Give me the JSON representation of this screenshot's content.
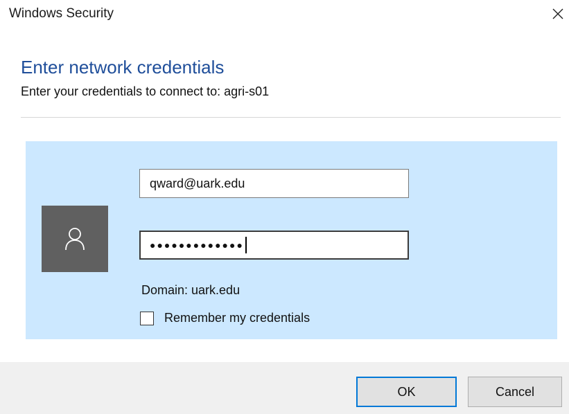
{
  "window": {
    "title": "Windows Security"
  },
  "header": {
    "heading": "Enter network credentials",
    "subheading": "Enter your credentials to connect to: agri-s01"
  },
  "credentials": {
    "username_value": "qward@uark.edu",
    "password_mask": "●●●●●●●●●●●●●",
    "domain_text": "Domain: uark.edu",
    "remember_label": "Remember my credentials",
    "remember_checked": false
  },
  "buttons": {
    "ok_label": "OK",
    "cancel_label": "Cancel"
  },
  "icons": {
    "close": "close-icon",
    "user": "user-icon"
  },
  "colors": {
    "heading": "#1f4e9a",
    "panel": "#cce8ff",
    "avatar": "#606060",
    "focus_border": "#0078d7",
    "footer": "#f0f0f0"
  }
}
